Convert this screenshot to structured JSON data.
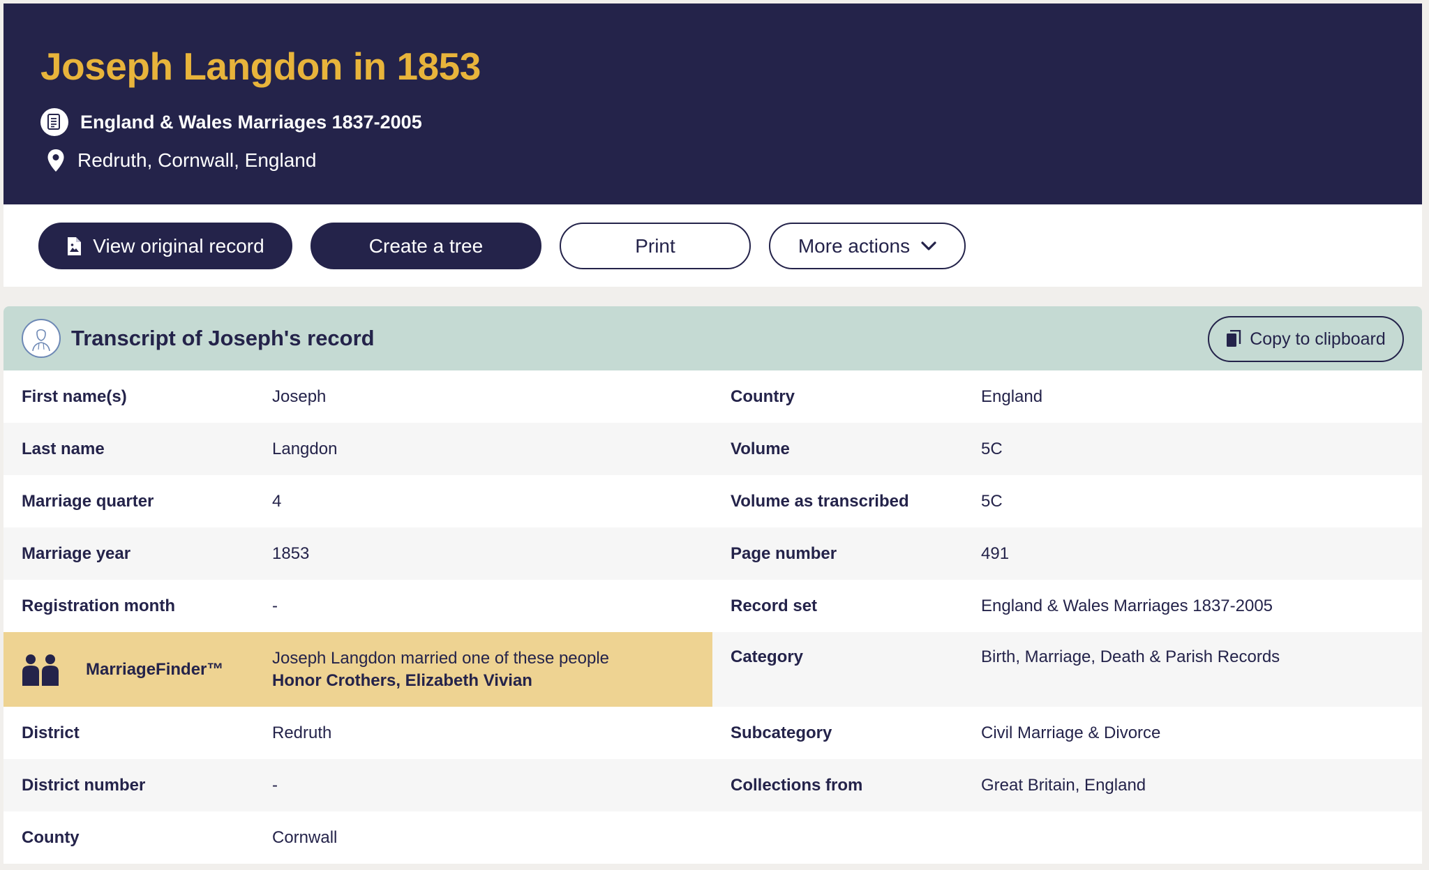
{
  "header": {
    "title": "Joseph Langdon in 1853",
    "collection": "England & Wales Marriages 1837-2005",
    "location": "Redruth, Cornwall, England"
  },
  "actions": {
    "view_original": "View original record",
    "create_tree": "Create a tree",
    "print": "Print",
    "more_actions": "More actions"
  },
  "transcript": {
    "title": "Transcript of Joseph's record",
    "copy_label": "Copy to clipboard",
    "left": [
      {
        "label": "First name(s)",
        "value": "Joseph"
      },
      {
        "label": "Last name",
        "value": "Langdon"
      },
      {
        "label": "Marriage quarter",
        "value": "4"
      },
      {
        "label": "Marriage year",
        "value": "1853"
      },
      {
        "label": "Registration month",
        "value": "-"
      },
      {
        "label": "District",
        "value": "Redruth"
      },
      {
        "label": "District number",
        "value": "-"
      },
      {
        "label": "County",
        "value": "Cornwall"
      }
    ],
    "right": [
      {
        "label": "Country",
        "value": "England"
      },
      {
        "label": "Volume",
        "value": "5C"
      },
      {
        "label": "Volume as transcribed",
        "value": "5C"
      },
      {
        "label": "Page number",
        "value": "491"
      },
      {
        "label": "Record set",
        "value": "England & Wales Marriages 1837-2005"
      },
      {
        "label": "Category",
        "value": "Birth, Marriage, Death & Parish Records"
      },
      {
        "label": "Subcategory",
        "value": "Civil Marriage & Divorce"
      },
      {
        "label": "Collections from",
        "value": "Great Britain, England"
      }
    ],
    "marriage_finder": {
      "label": "MarriageFinder™",
      "line": "Joseph Langdon married one of these people",
      "names": "Honor Crothers, Elizabeth Vivian"
    }
  },
  "colors": {
    "navy": "#24234a",
    "gold": "#e8b43b",
    "mint": "#c5dad3",
    "finder": "#eed392"
  }
}
